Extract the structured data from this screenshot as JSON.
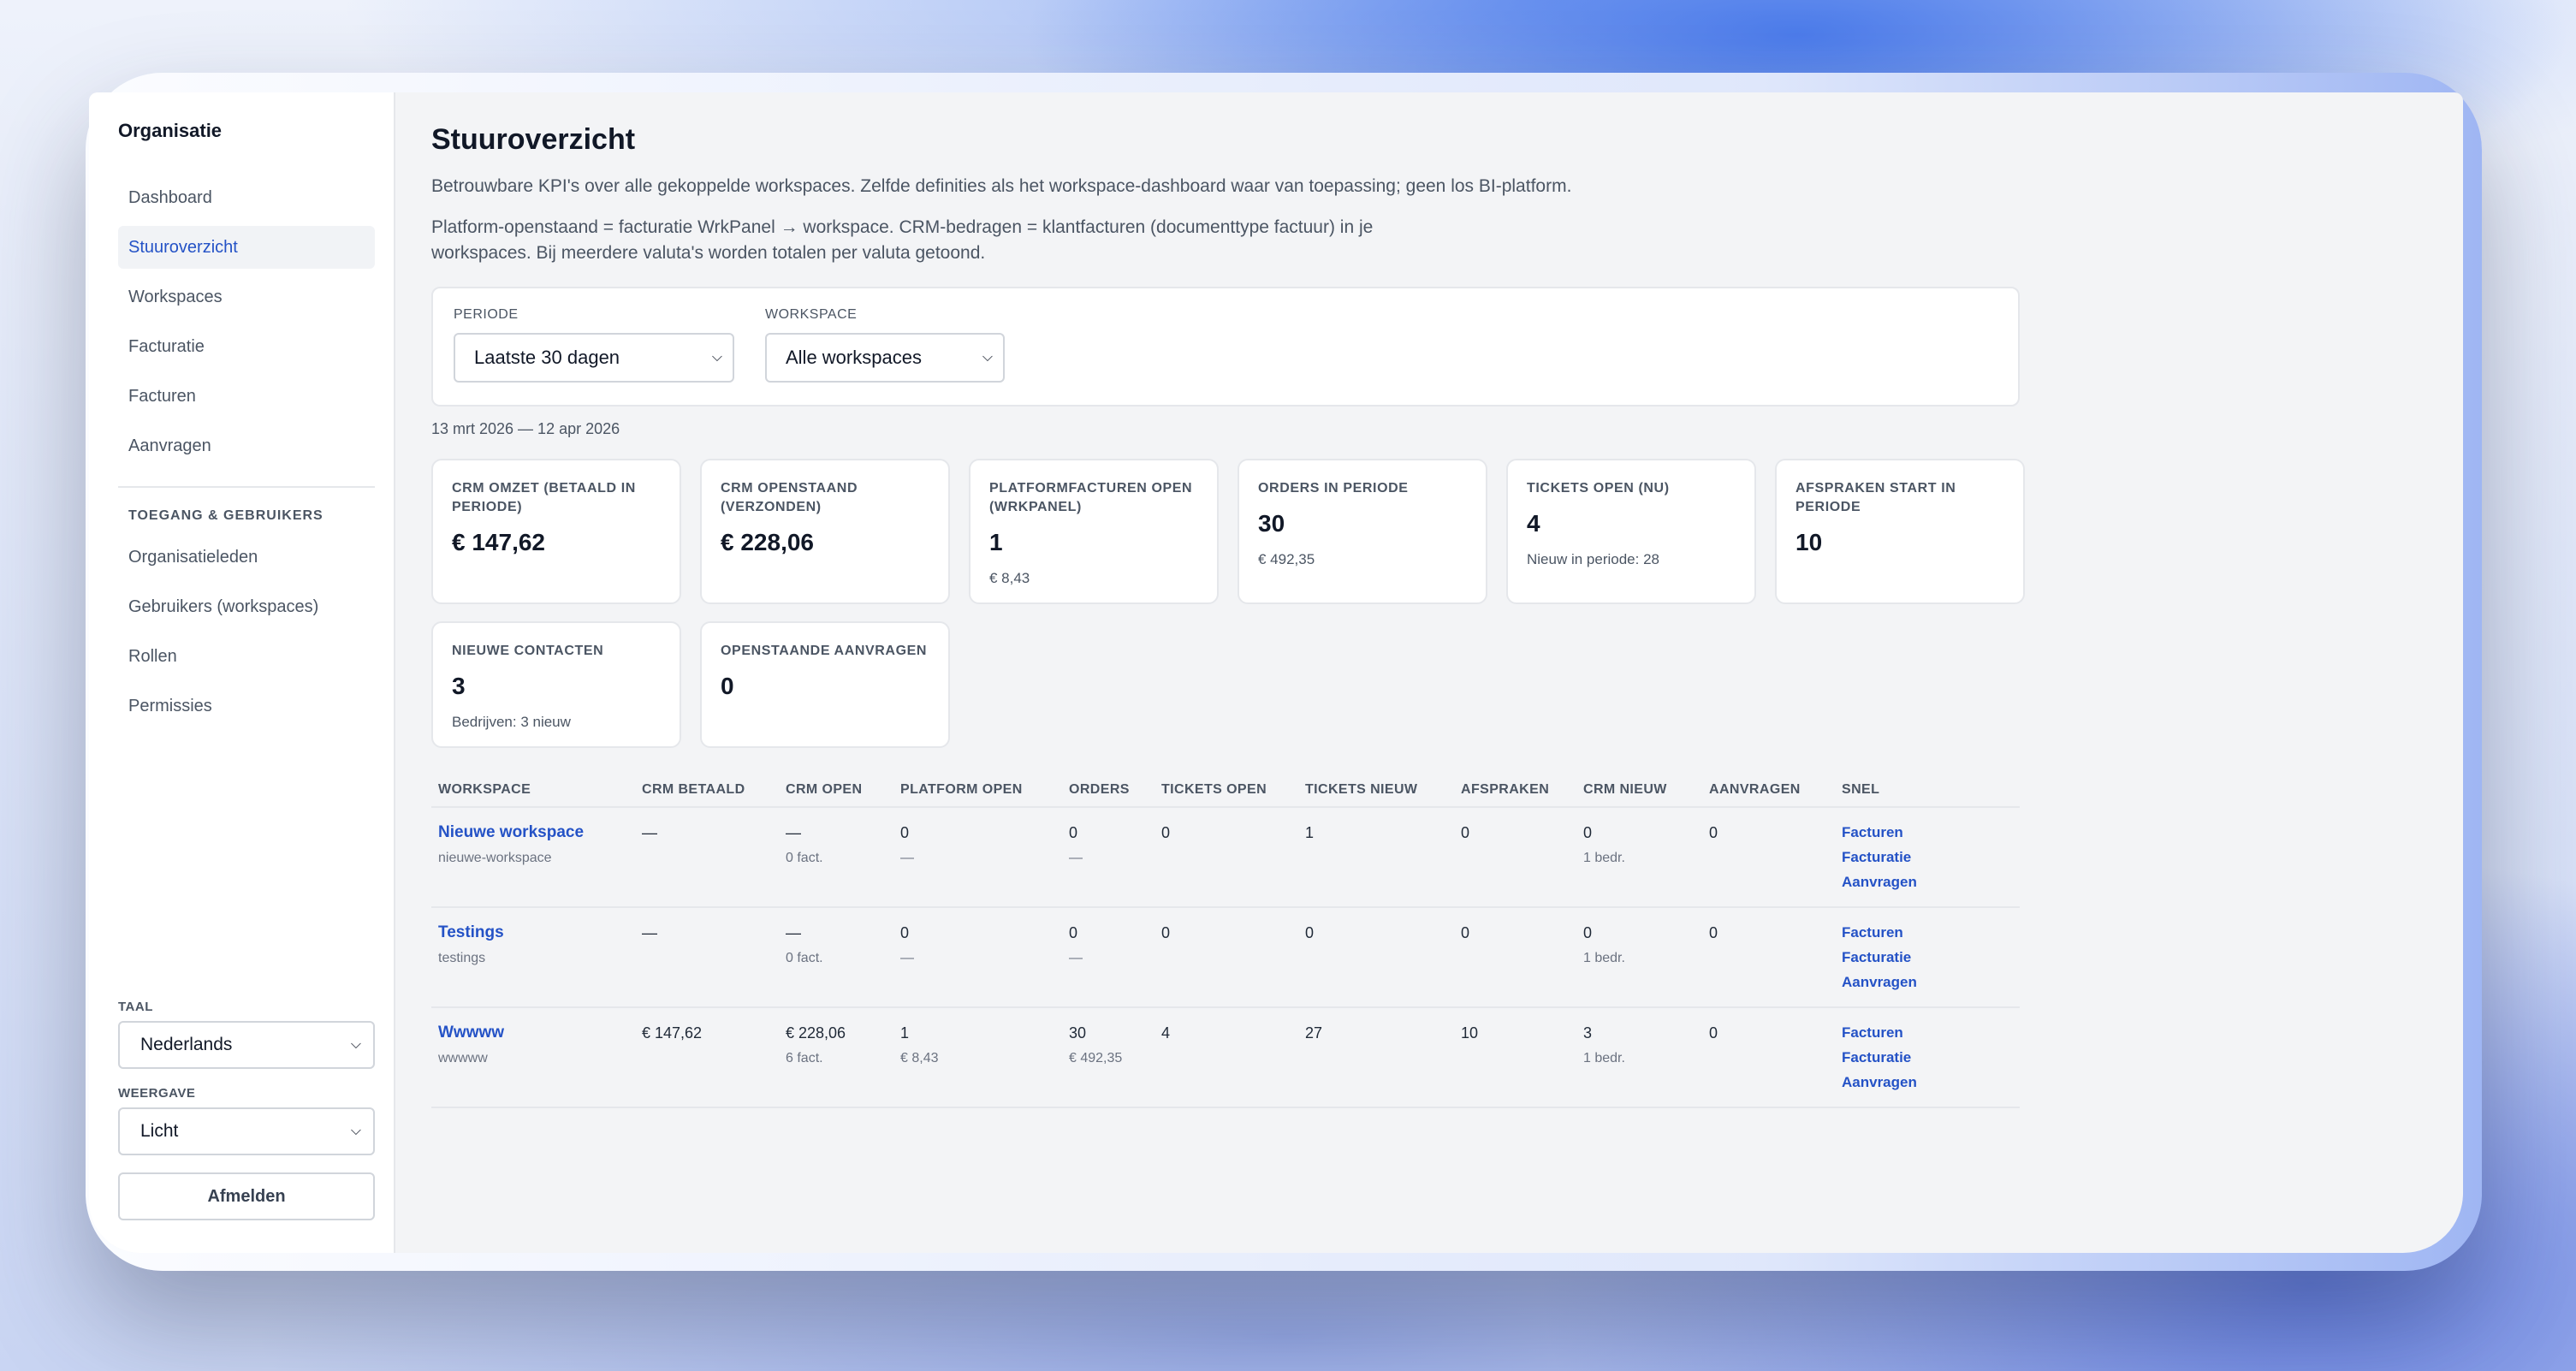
{
  "sidebar": {
    "org_title": "Organisatie",
    "nav": [
      {
        "label": "Dashboard"
      },
      {
        "label": "Stuuroverzicht"
      },
      {
        "label": "Workspaces"
      },
      {
        "label": "Facturatie"
      },
      {
        "label": "Facturen"
      },
      {
        "label": "Aanvragen"
      }
    ],
    "access_section": "TOEGANG & GEBRUIKERS",
    "access_items": [
      {
        "label": "Organisatieleden"
      },
      {
        "label": "Gebruikers (workspaces)"
      },
      {
        "label": "Rollen"
      },
      {
        "label": "Permissies"
      }
    ],
    "language_label": "TAAL",
    "language_value": "Nederlands",
    "display_label": "WEERGAVE",
    "display_value": "Licht",
    "logout_label": "Afmelden"
  },
  "main": {
    "title": "Stuuroverzicht",
    "description1": "Betrouwbare KPI's over alle gekoppelde workspaces. Zelfde definities als het workspace-dashboard waar van toepassing; geen los BI-platform.",
    "description2": "Platform-openstaand = facturatie WrkPanel → workspace. CRM-bedragen = klantfacturen (documenttype factuur) in je workspaces. Bij meerdere valuta's worden totalen per valuta getoond.",
    "filters": {
      "period_label": "PERIODE",
      "period_value": "Laatste 30 dagen",
      "workspace_label": "WORKSPACE",
      "workspace_value": "Alle workspaces"
    },
    "date_range": "13 mrt 2026 — 12 apr 2026",
    "kpis": [
      {
        "label": "CRM OMZET (BETAALD IN PERIODE)",
        "value": "€ 147,62",
        "sub": ""
      },
      {
        "label": "CRM OPENSTAAND (VERZONDEN)",
        "value": "€ 228,06",
        "sub": ""
      },
      {
        "label": "PLATFORMFACTUREN OPEN (WRKPANEL)",
        "value": "1",
        "sub": "€ 8,43"
      },
      {
        "label": "ORDERS IN PERIODE",
        "value": "30",
        "sub": "€ 492,35"
      },
      {
        "label": "TICKETS OPEN (NU)",
        "value": "4",
        "sub": "Nieuw in periode: 28"
      },
      {
        "label": "AFSPRAKEN START IN PERIODE",
        "value": "10",
        "sub": ""
      },
      {
        "label": "NIEUWE CONTACTEN",
        "value": "3",
        "sub": "Bedrijven: 3 nieuw"
      },
      {
        "label": "OPENSTAANDE AANVRAGEN",
        "value": "0",
        "sub": ""
      }
    ],
    "table": {
      "headers": [
        "WORKSPACE",
        "CRM BETAALD",
        "CRM OPEN",
        "PLATFORM OPEN",
        "ORDERS",
        "TICKETS OPEN",
        "TICKETS NIEUW",
        "AFSPRAKEN",
        "CRM NIEUW",
        "AANVRAGEN",
        "SNEL"
      ],
      "quick_links": [
        "Facturen",
        "Facturatie",
        "Aanvragen"
      ],
      "rows": [
        {
          "name": "Nieuwe workspace",
          "slug": "nieuwe-workspace",
          "crm_paid": "—",
          "crm_open": "—",
          "crm_open_sub": "0 fact.",
          "platform_open": "0",
          "platform_open_sub": "—",
          "orders": "0",
          "orders_sub": "—",
          "tickets_open": "0",
          "tickets_new": "1",
          "appointments": "0",
          "crm_new": "0",
          "crm_new_sub": "1 bedr.",
          "requests": "0"
        },
        {
          "name": "Testings",
          "slug": "testings",
          "crm_paid": "—",
          "crm_open": "—",
          "crm_open_sub": "0 fact.",
          "platform_open": "0",
          "platform_open_sub": "—",
          "orders": "0",
          "orders_sub": "—",
          "tickets_open": "0",
          "tickets_new": "0",
          "appointments": "0",
          "crm_new": "0",
          "crm_new_sub": "1 bedr.",
          "requests": "0"
        },
        {
          "name": "Wwwww",
          "slug": "wwwww",
          "crm_paid": "€ 147,62",
          "crm_open": "€ 228,06",
          "crm_open_sub": "6 fact.",
          "platform_open": "1",
          "platform_open_sub": "€ 8,43",
          "orders": "30",
          "orders_sub": "€ 492,35",
          "tickets_open": "4",
          "tickets_new": "27",
          "appointments": "10",
          "crm_new": "3",
          "crm_new_sub": "1 bedr.",
          "requests": "0"
        }
      ]
    }
  }
}
